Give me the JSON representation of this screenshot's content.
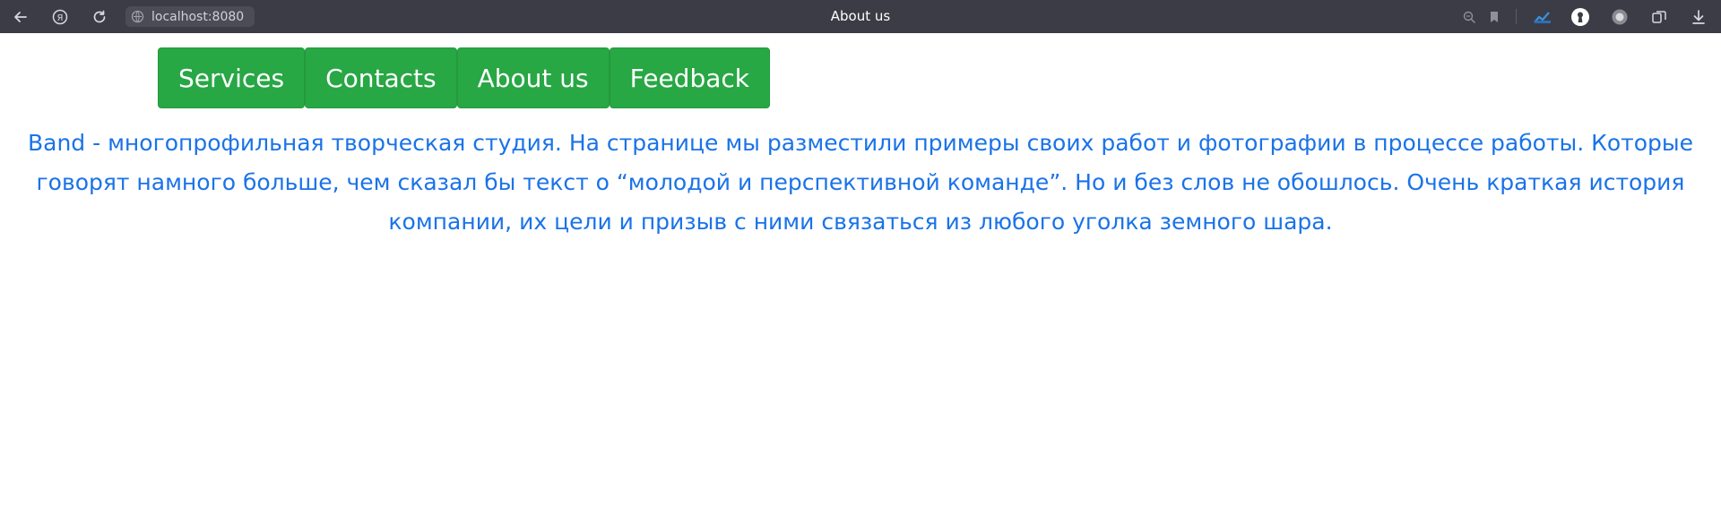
{
  "browser": {
    "url": "localhost:8080",
    "window_title": "About us",
    "icons": [
      "back-arrow-icon",
      "yandex-icon",
      "reload-icon",
      "site-info-icon",
      "reader-mode-icon",
      "bookmark-icon",
      "extension-chart-icon",
      "keyhole-icon",
      "record-icon",
      "tabs-icon",
      "download-icon"
    ]
  },
  "nav": {
    "items": [
      {
        "label": "Services"
      },
      {
        "label": "Contacts"
      },
      {
        "label": "About us"
      },
      {
        "label": "Feedback"
      }
    ],
    "color": "#28a745"
  },
  "content": {
    "paragraph": "Band - многопрофильная творческая студия. На странице мы разместили примеры своих работ и фотографии в процессе работы. Которые говорят намного больше, чем сказал бы текст о “молодой и перспективной команде”. Но и без слов не обошлось. Очень краткая история компании, их цели и призыв с ними связаться из любого уголка земного шара.",
    "text_color": "#1a73e8"
  }
}
